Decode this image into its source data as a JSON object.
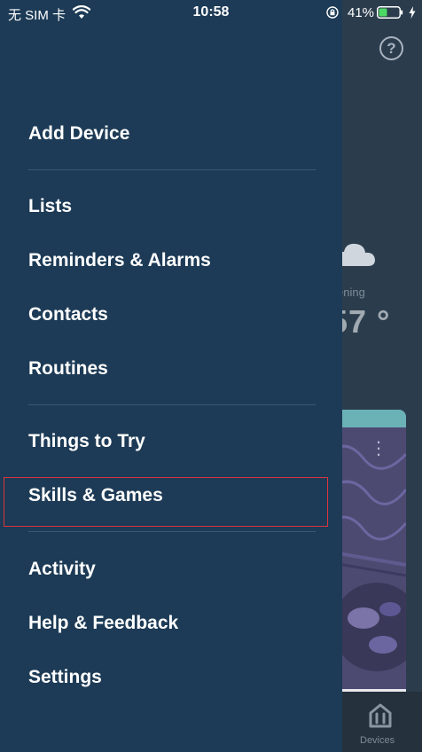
{
  "status_bar": {
    "carrier": "无 SIM 卡",
    "time": "10:58",
    "battery_percent": "41%",
    "battery_level": 0.41,
    "battery_color": "#4cd964"
  },
  "background": {
    "help_label": "?",
    "weather_label": "ening",
    "temperature": "57 °",
    "tab_devices_label": "Devices"
  },
  "drawer": {
    "items": [
      {
        "label": "Add Device"
      },
      {
        "label": "Lists"
      },
      {
        "label": "Reminders & Alarms"
      },
      {
        "label": "Contacts"
      },
      {
        "label": "Routines"
      },
      {
        "label": "Things to Try"
      },
      {
        "label": "Skills & Games"
      },
      {
        "label": "Activity"
      },
      {
        "label": "Help & Feedback"
      },
      {
        "label": "Settings"
      }
    ],
    "highlighted_item": "Skills & Games",
    "highlight_color": "#d9363e",
    "background_color": "#1d3b56"
  }
}
